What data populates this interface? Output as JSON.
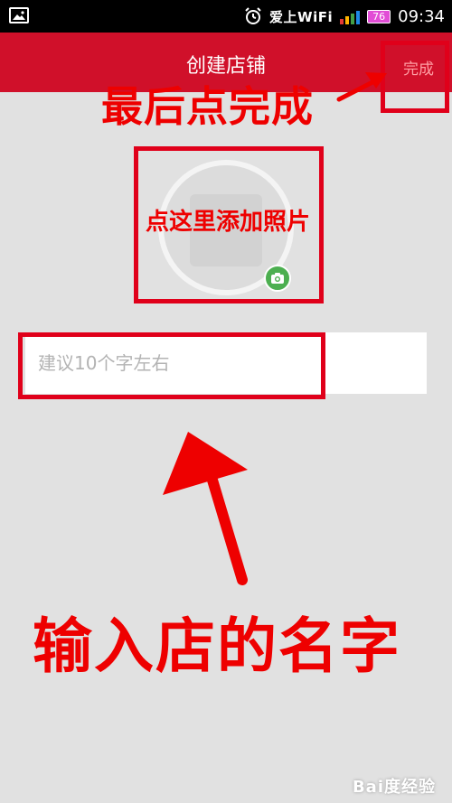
{
  "status_bar": {
    "wifi_brand": "爱上WiFi",
    "battery": "76",
    "time": "09:34"
  },
  "app_bar": {
    "title": "创建店铺",
    "done_label": "完成"
  },
  "name_input": {
    "placeholder": "建议10个字左右",
    "value": ""
  },
  "annotations": {
    "finish_hint": "最后点完成",
    "photo_hint": "点这里添加照片",
    "name_hint": "输入店的名字"
  },
  "watermark": "Bai度经验",
  "colors": {
    "app_bar": "#d0102a",
    "background": "#e1e1e1",
    "annotation": "#e0001a",
    "camera_badge": "#4caf50"
  },
  "icons": [
    "image-icon",
    "alarm-clock-icon",
    "signal-bars-icon",
    "battery-icon",
    "camera-icon"
  ]
}
